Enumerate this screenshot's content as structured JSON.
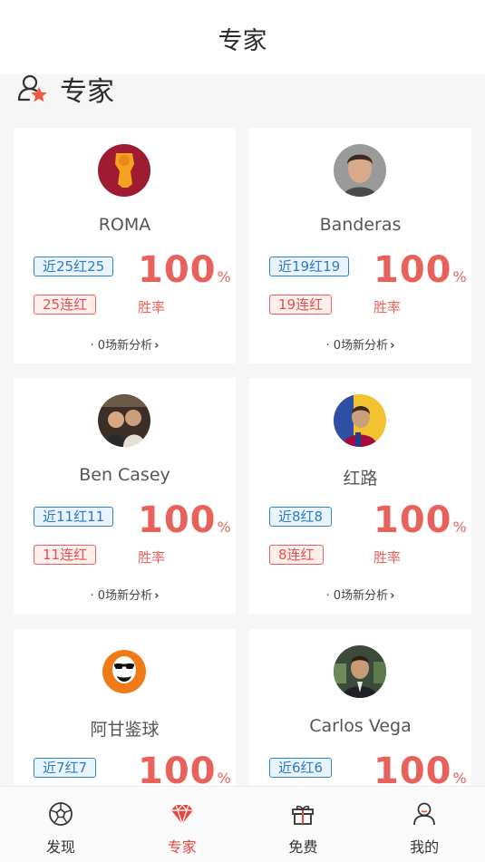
{
  "header": {
    "title": "专家"
  },
  "section": {
    "title": "专家"
  },
  "experts": [
    {
      "name": "ROMA",
      "recent": "近25红25",
      "streak": "25连红",
      "rate_num": "100",
      "rate_unit": "%",
      "rate_label": "胜率",
      "new_analysis": "· 0场新分析",
      "chevron": "›",
      "avatar_icon": "roma-logo-avatar"
    },
    {
      "name": "Banderas",
      "recent": "近19红19",
      "streak": "19连红",
      "rate_num": "100",
      "rate_unit": "%",
      "rate_label": "胜率",
      "new_analysis": "· 0场新分析",
      "chevron": "›",
      "avatar_icon": "man-portrait-avatar"
    },
    {
      "name": "Ben Casey",
      "recent": "近11红11",
      "streak": "11连红",
      "rate_num": "100",
      "rate_unit": "%",
      "rate_label": "胜率",
      "new_analysis": "· 0场新分析",
      "chevron": "›",
      "avatar_icon": "group-photo-avatar"
    },
    {
      "name": "红路",
      "recent": "近8红8",
      "streak": "8连红",
      "rate_num": "100",
      "rate_unit": "%",
      "rate_label": "胜率",
      "new_analysis": "· 0场新分析",
      "chevron": "›",
      "avatar_icon": "footballer-avatar"
    },
    {
      "name": "阿甘鉴球",
      "recent": "近7红7",
      "streak": "",
      "rate_num": "100",
      "rate_unit": "%",
      "rate_label": "",
      "new_analysis": "",
      "chevron": "",
      "avatar_icon": "cartoon-man-avatar"
    },
    {
      "name": "Carlos Vega",
      "recent": "近6红6",
      "streak": "",
      "rate_num": "100",
      "rate_unit": "%",
      "rate_label": "",
      "new_analysis": "",
      "chevron": "",
      "avatar_icon": "suited-man-avatar"
    }
  ],
  "tabs": [
    {
      "label": "发现",
      "icon": "soccer-ball-icon",
      "active": false
    },
    {
      "label": "专家",
      "icon": "diamond-icon",
      "active": true
    },
    {
      "label": "免费",
      "icon": "gift-icon",
      "active": false
    },
    {
      "label": "我的",
      "icon": "user-icon",
      "active": false
    }
  ],
  "colors": {
    "accent": "#e8625b",
    "blue": "#2f86cc",
    "active_tab": "#e8473f"
  }
}
